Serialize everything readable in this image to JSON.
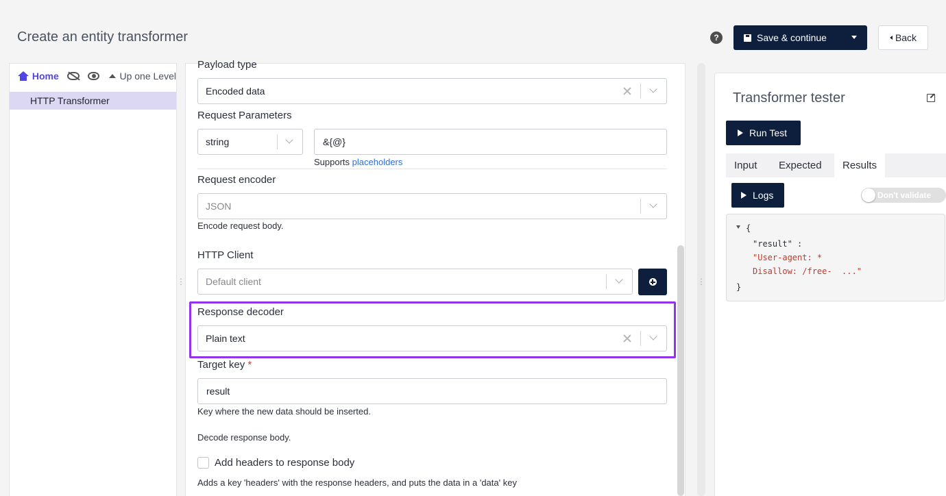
{
  "header": {
    "title": "Create an entity transformer",
    "help_glyph": "?",
    "save_label": "Save & continue",
    "back_label": "Back"
  },
  "tree": {
    "home_label": "Home",
    "up_label": "Up one Level",
    "items": [
      {
        "label": "HTTP Transformer"
      }
    ]
  },
  "form": {
    "payload_type": {
      "label": "Payload type",
      "value": "Encoded data"
    },
    "request_parameters": {
      "label": "Request Parameters",
      "type_value": "string",
      "param_value": "&{@}",
      "help_prefix": "Supports",
      "help_link": "placeholders"
    },
    "request_encoder": {
      "label": "Request encoder",
      "value": "JSON",
      "help": "Encode request body."
    },
    "http_client": {
      "label": "HTTP Client",
      "value": "Default client"
    },
    "response_decoder": {
      "label": "Response decoder",
      "value": "Plain text"
    },
    "target_key": {
      "label": "Target key",
      "required_mark": "*",
      "value": "result",
      "help": "Key where the new data should be inserted."
    },
    "decode_help": "Decode response body.",
    "add_headers": {
      "label": "Add headers to response body",
      "help": "Adds a key 'headers' with the response headers, and puts the data in a 'data' key"
    }
  },
  "tester": {
    "title": "Transformer tester",
    "run_label": "Run Test",
    "tabs": [
      "Input",
      "Expected",
      "Results"
    ],
    "active_tab": "Results",
    "logs_label": "Logs",
    "toggle_label": "Don't validate",
    "code": {
      "open": "{",
      "key": "\"result\" :",
      "value_line1": "\"User-agent: *",
      "value_line2": "Disallow: /free-  ...\"",
      "close": "}"
    }
  },
  "colors": {
    "primary": "#0d1f3c",
    "highlight": "#9333ea",
    "link": "#2f6fd6",
    "accent": "#4f46e5"
  }
}
